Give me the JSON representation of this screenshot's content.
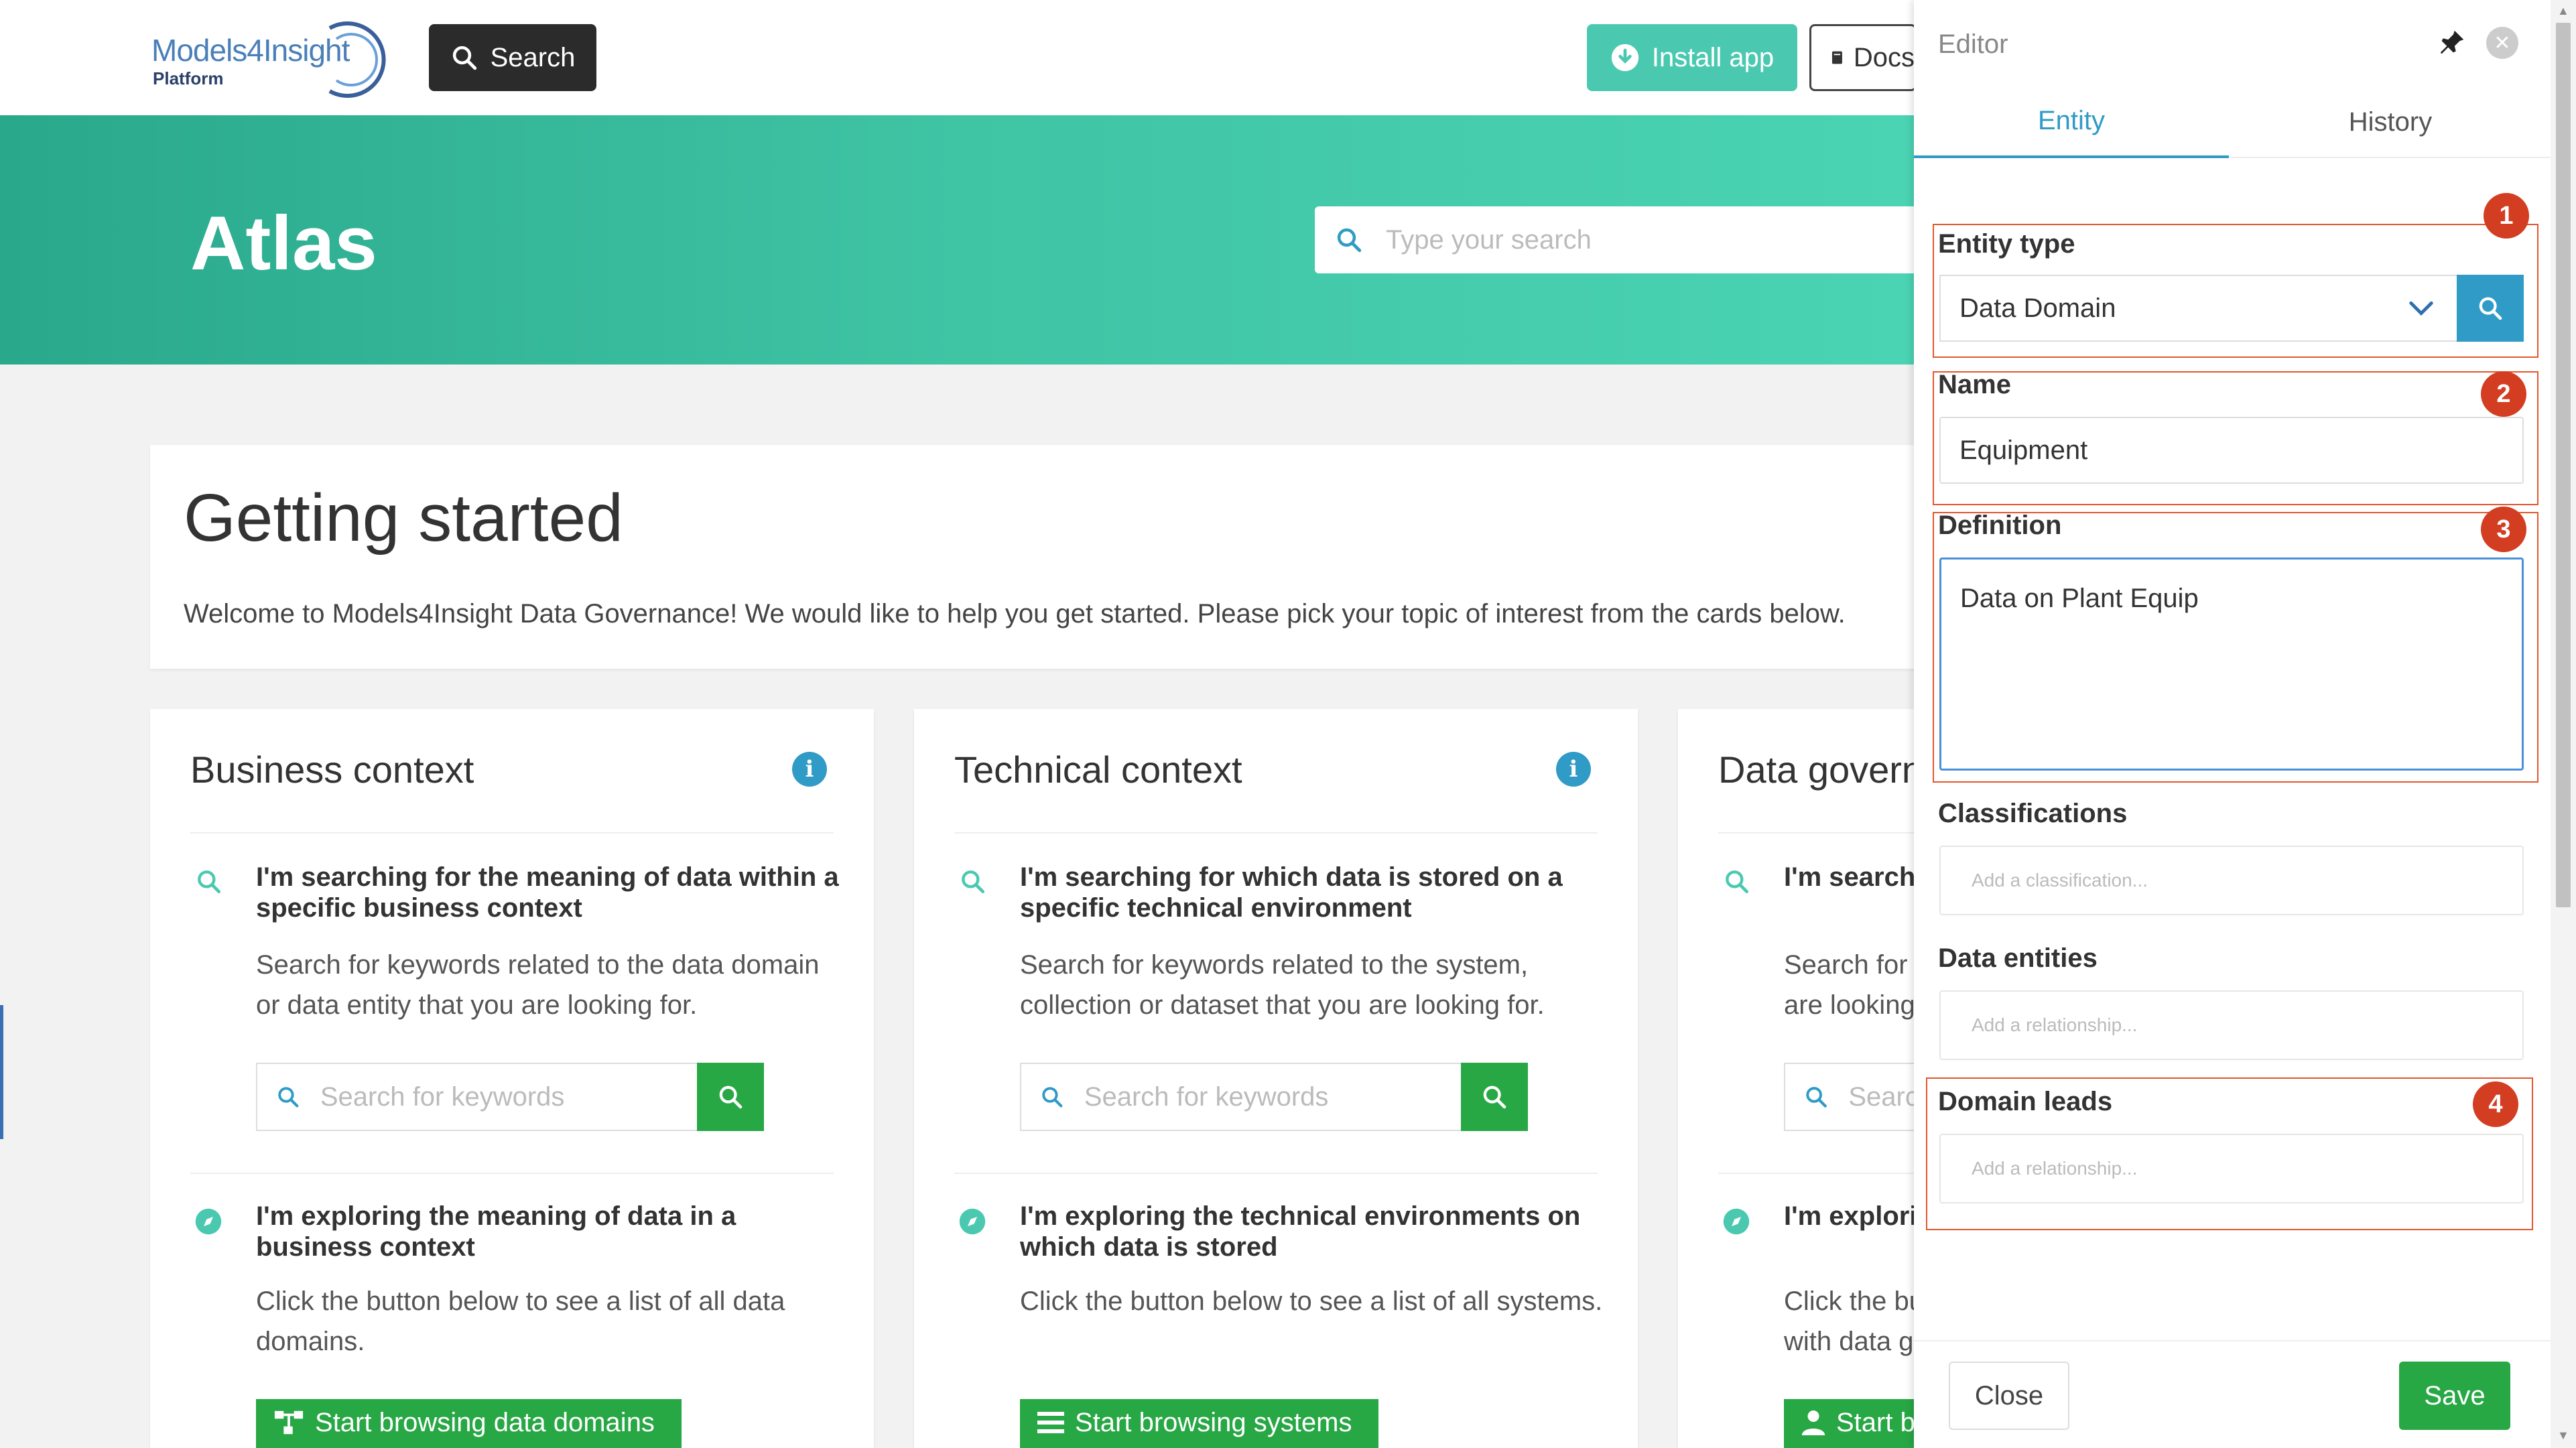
{
  "app": {
    "logo_main": "Models4Insight",
    "logo_sub": "Platform",
    "search_button": "Search",
    "install_button": "Install app",
    "docs_button": "Docs"
  },
  "hero": {
    "title": "Atlas",
    "search_placeholder": "Type your search"
  },
  "getting_started": {
    "title": "Getting started",
    "text": "Welcome to Models4Insight Data Governance! We would like to help you get started. Please pick your topic of interest from the cards below."
  },
  "cards": [
    {
      "title": "Business context",
      "search_heading": "I'm searching for the meaning of data within a specific business context",
      "search_desc": "Search for keywords related to the data domain or data entity that you are looking for.",
      "search_placeholder": "Search for keywords",
      "explore_heading": "I'm exploring the meaning of data in a business context",
      "explore_desc": "Click the button below to see a list of all data domains.",
      "browse_button": "Start browsing data domains"
    },
    {
      "title": "Technical context",
      "search_heading": "I'm searching for which data is stored on a specific technical environment",
      "search_desc": "Search for keywords related to the system, collection or dataset that you are looking for.",
      "search_placeholder": "Search for keywords",
      "explore_heading": "I'm exploring the technical environments on which data is stored",
      "explore_desc": "Click the button below to see a list of all systems.",
      "browse_button": "Start browsing systems"
    },
    {
      "title": "Data governance",
      "search_heading": "I'm searching for the responsibilities",
      "search_desc": "Search for keywords related to the person you are looking for.",
      "search_placeholder": "Search for keywords",
      "explore_heading": "I'm exploring the responsibilities",
      "explore_desc": "Click the button below to see a list of all people with data governance roles.",
      "browse_button": "Start browsing"
    }
  ],
  "editor": {
    "title": "Editor",
    "tabs": [
      "Entity",
      "History"
    ],
    "entity_type_label": "Entity type",
    "entity_type_value": "Data Domain",
    "name_label": "Name",
    "name_value": "Equipment",
    "definition_label": "Definition",
    "definition_value": "Data on Plant Equip",
    "classifications_label": "Classifications",
    "classifications_placeholder": "Add a classification...",
    "data_entities_label": "Data entities",
    "data_entities_placeholder": "Add a relationship...",
    "domain_leads_label": "Domain leads",
    "domain_leads_placeholder": "Add a relationship...",
    "badges": [
      "1",
      "2",
      "3",
      "4"
    ],
    "close_button": "Close",
    "save_button": "Save"
  },
  "colors": {
    "hero_start": "#2aa88c",
    "hero_end": "#4ad4b4",
    "accent_blue": "#2f9bc6",
    "green": "#28a745",
    "badge_red": "#d33d22",
    "highlight_border": "#e4562c"
  },
  "icons": [
    "search-icon",
    "download-icon",
    "book-icon",
    "info-icon",
    "compass-icon",
    "sitemap-icon",
    "list-icon",
    "person-icon",
    "pin-icon",
    "close-icon",
    "chevron-down-icon"
  ]
}
